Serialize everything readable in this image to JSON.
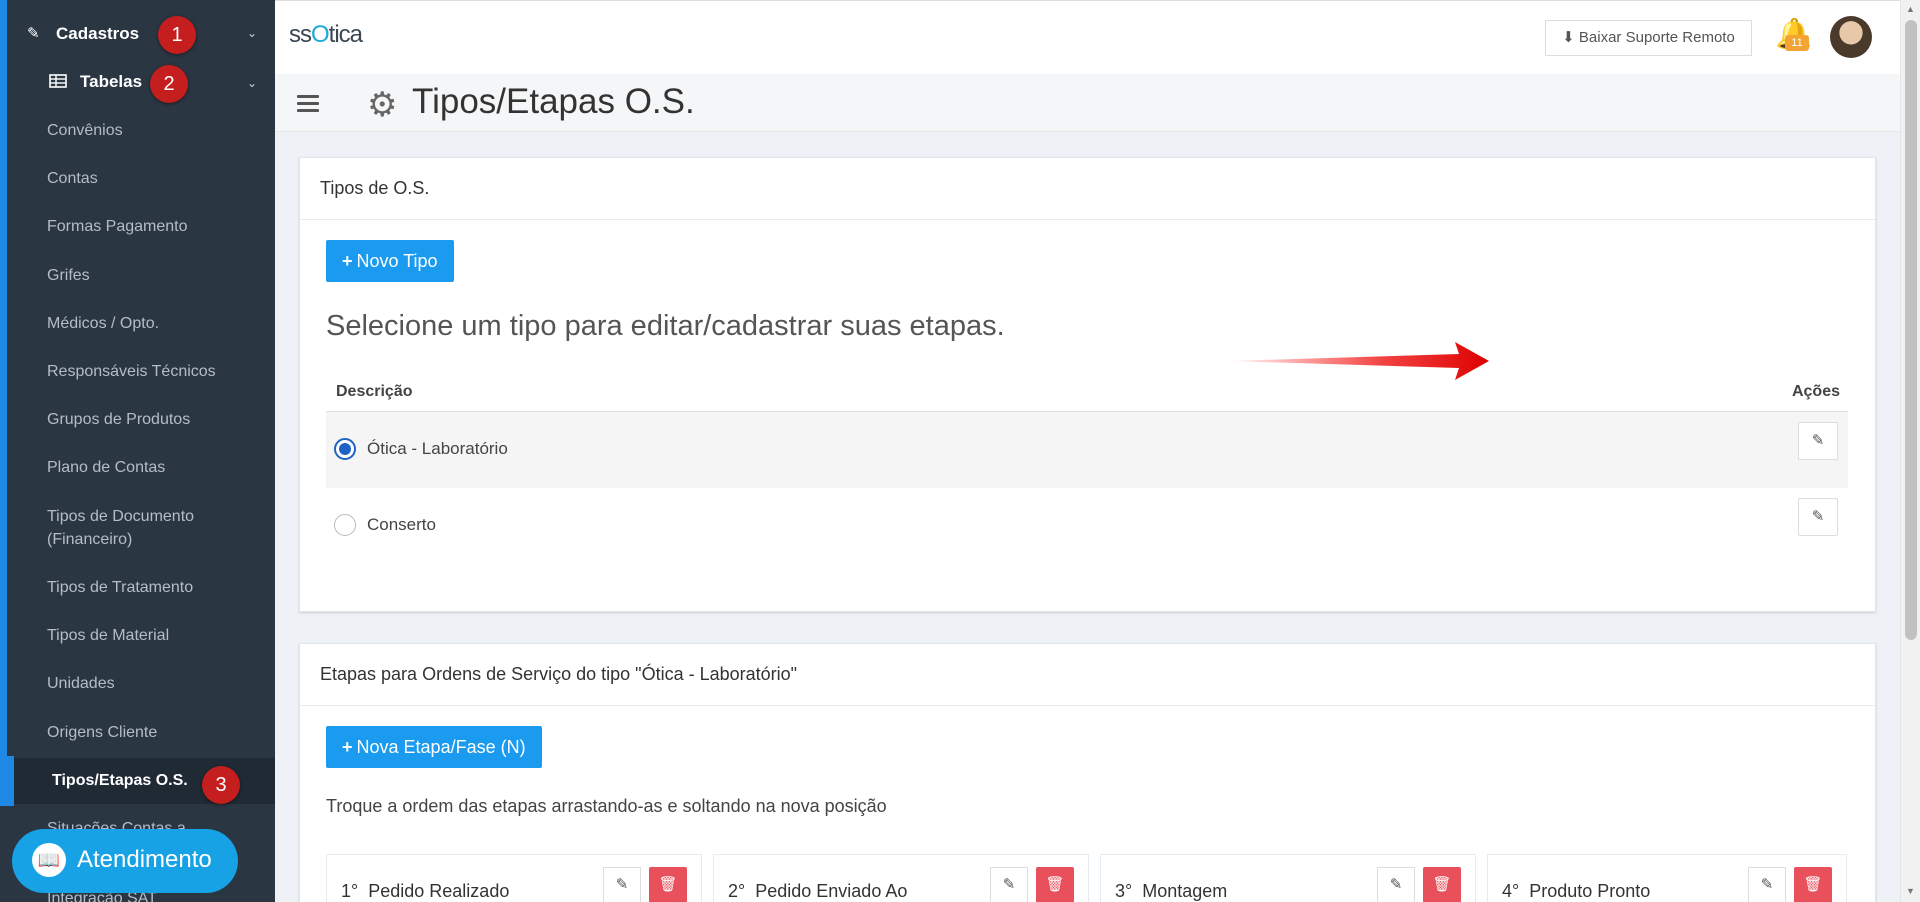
{
  "sidebar": {
    "cadastros": "Cadastros",
    "tabelas": "Tabelas",
    "items": [
      "Convênios",
      "Contas",
      "Formas Pagamento",
      "Grifes",
      "Médicos / Opto.",
      "Responsáveis Técnicos",
      "Grupos de Produtos",
      "Plano de Contas",
      "Tipos de Documento (Financeiro)",
      "Tipos de Tratamento",
      "Tipos de Material",
      "Unidades",
      "Origens Cliente",
      "Tipos/Etapas O.S.",
      "Situações Contas a",
      "Integração SAT"
    ],
    "active_item": "Tipos/Etapas O.S.",
    "step_badges": [
      "1",
      "2",
      "3"
    ]
  },
  "atendimento": {
    "label": "Atendimento"
  },
  "topbar": {
    "logo": "ssOtica",
    "remote_button": "Baixar Suporte Remoto",
    "notification_count": "11"
  },
  "page": {
    "title": "Tipos/Etapas O.S."
  },
  "tipos_panel": {
    "title": "Tipos de O.S.",
    "new_button": "Novo Tipo",
    "hint": "Selecione um tipo para editar/cadastrar suas etapas.",
    "col_description": "Descrição",
    "col_actions": "Ações",
    "rows": [
      {
        "label": "Ótica - Laboratório",
        "selected": true
      },
      {
        "label": "Conserto",
        "selected": false
      }
    ]
  },
  "etapas_panel": {
    "title": "Etapas para Ordens de Serviço do tipo \"Ótica - Laboratório\"",
    "new_button": "Nova Etapa/Fase (N)",
    "hint": "Troque a ordem das etapas arrastando-as e soltando na nova posição",
    "stages": [
      {
        "order": "1°",
        "name": "Pedido Realizado"
      },
      {
        "order": "2°",
        "name": "Pedido Enviado Ao"
      },
      {
        "order": "3°",
        "name": "Montagem"
      },
      {
        "order": "4°",
        "name": "Produto Pronto"
      }
    ]
  },
  "colors": {
    "sidebar_bg": "#2b3643",
    "accent_blue": "#1a9bef",
    "badge_red": "#c41e1e",
    "delete_red": "#e8505b"
  }
}
